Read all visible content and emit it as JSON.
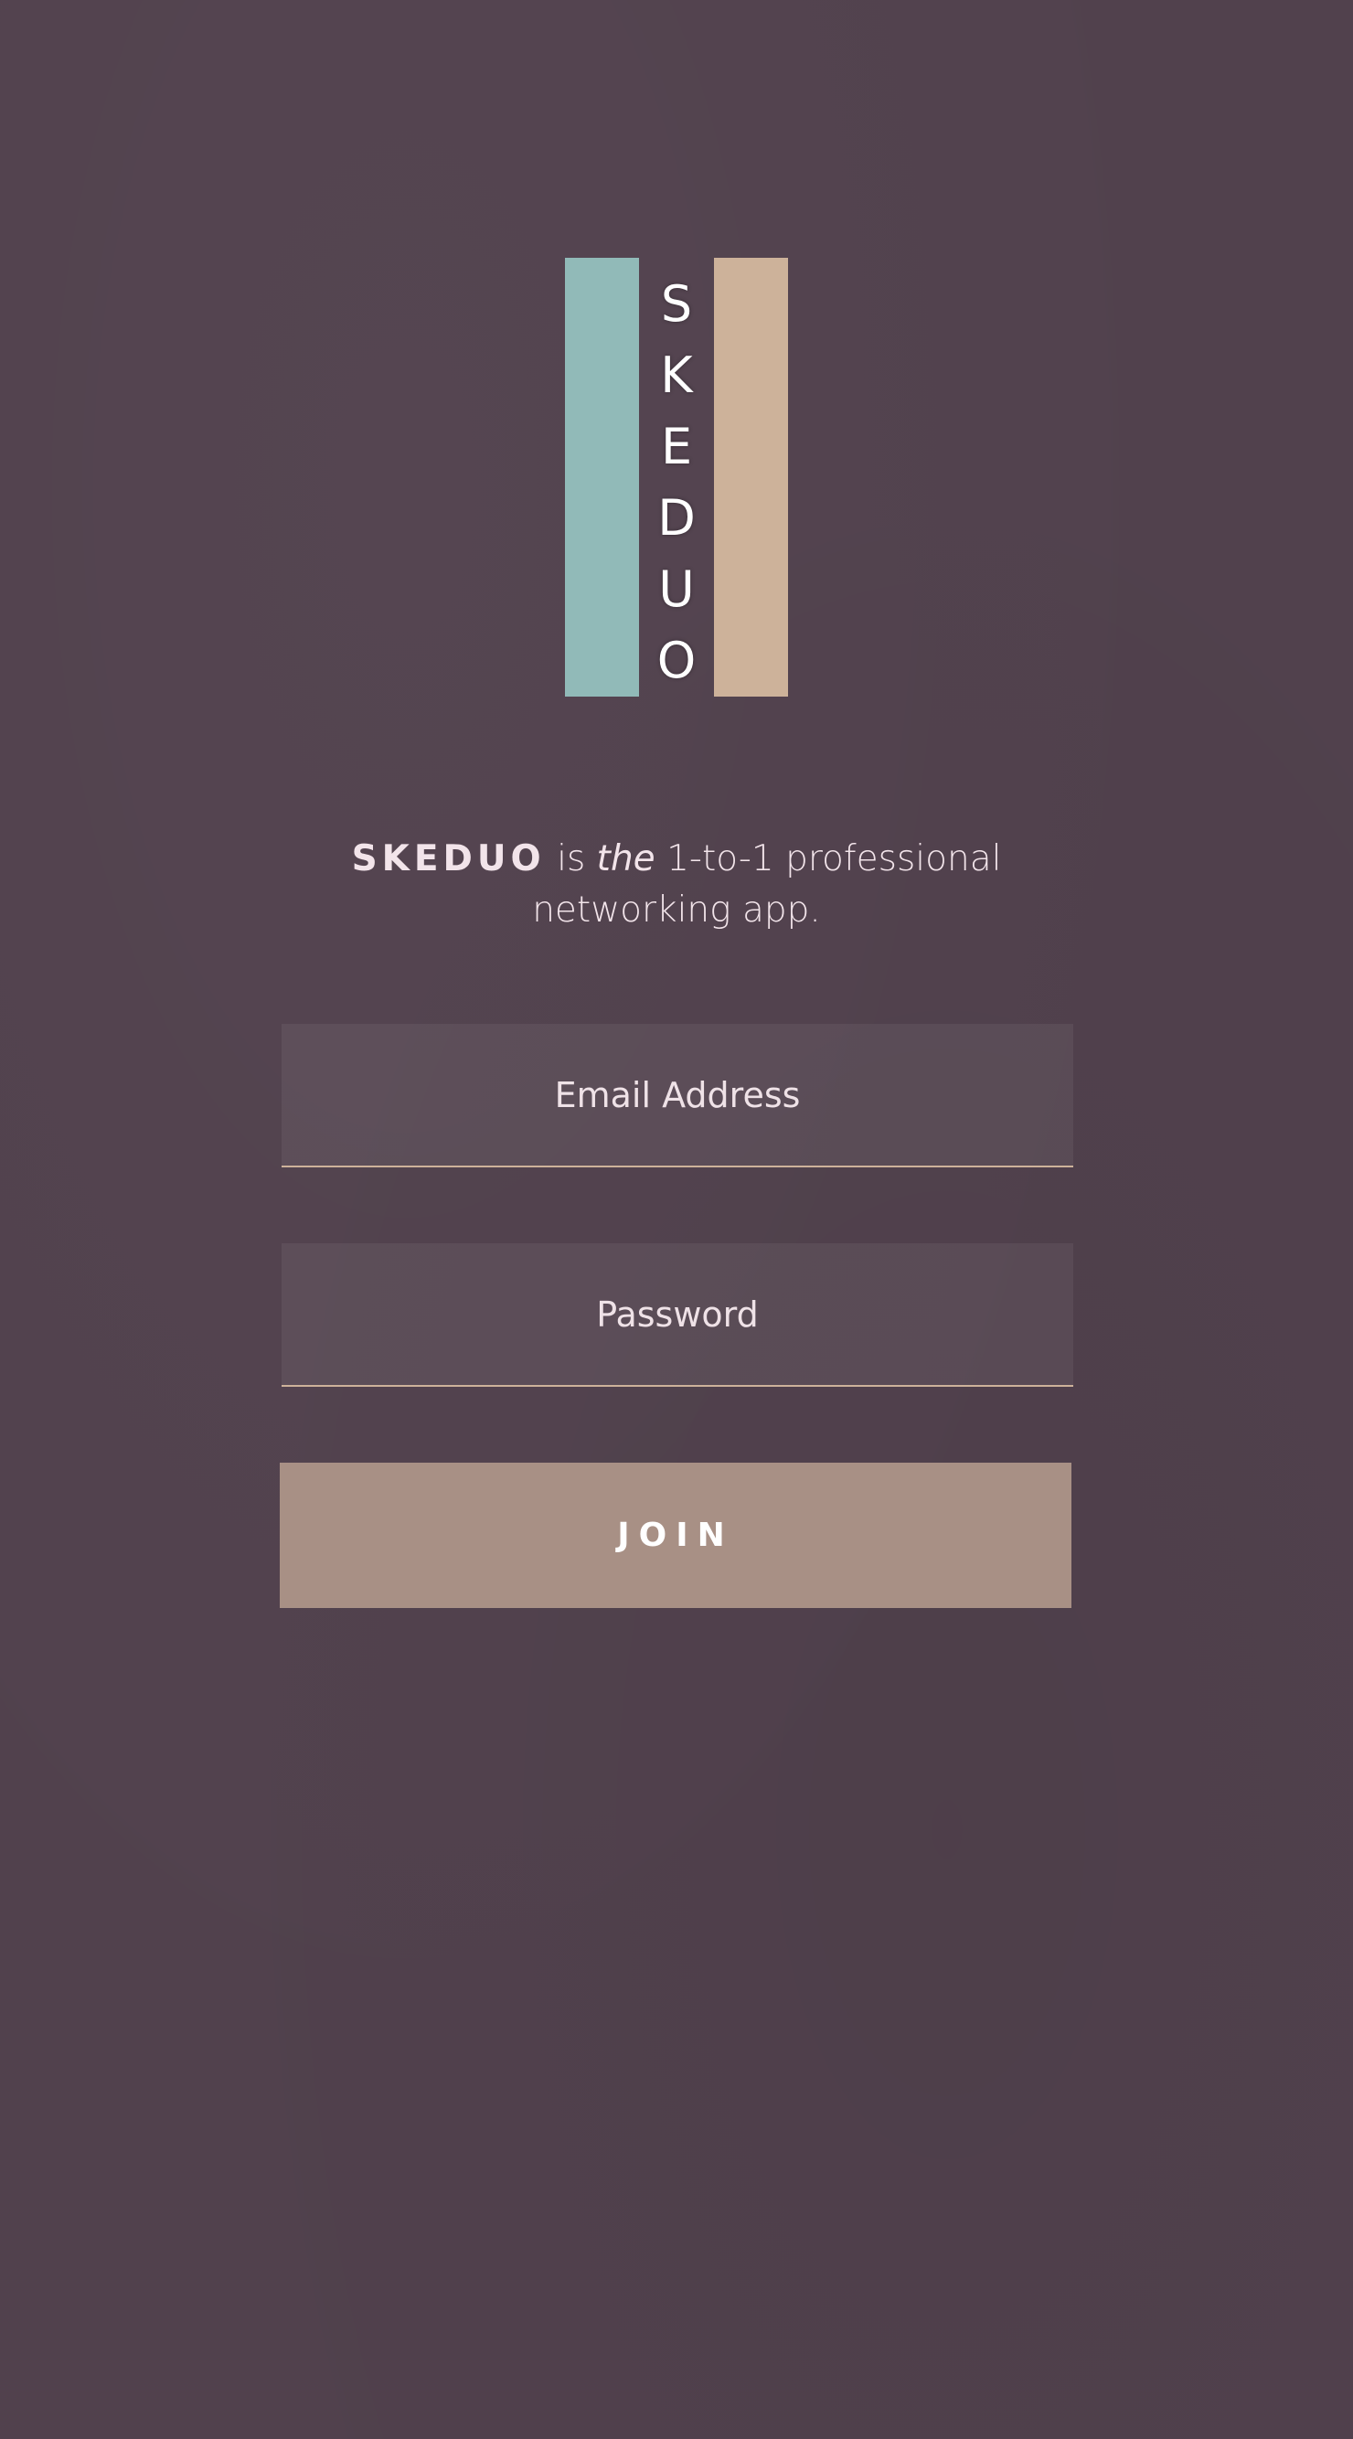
{
  "logo": {
    "letters": [
      "S",
      "K",
      "E",
      "D",
      "U",
      "O"
    ],
    "left_bar_color": "#91bab8",
    "right_bar_color": "#cdb29a"
  },
  "tagline": {
    "brand": "SKEDUO",
    "part1": " is ",
    "emphasis": "the",
    "part2": " 1-to-1 professional networking app."
  },
  "form": {
    "email_placeholder": "Email Address",
    "password_placeholder": "Password",
    "join_label": "JOIN"
  },
  "colors": {
    "background": "#51414d",
    "accent": "#cdb29a",
    "button": "#a89085",
    "teal": "#91bab8"
  }
}
